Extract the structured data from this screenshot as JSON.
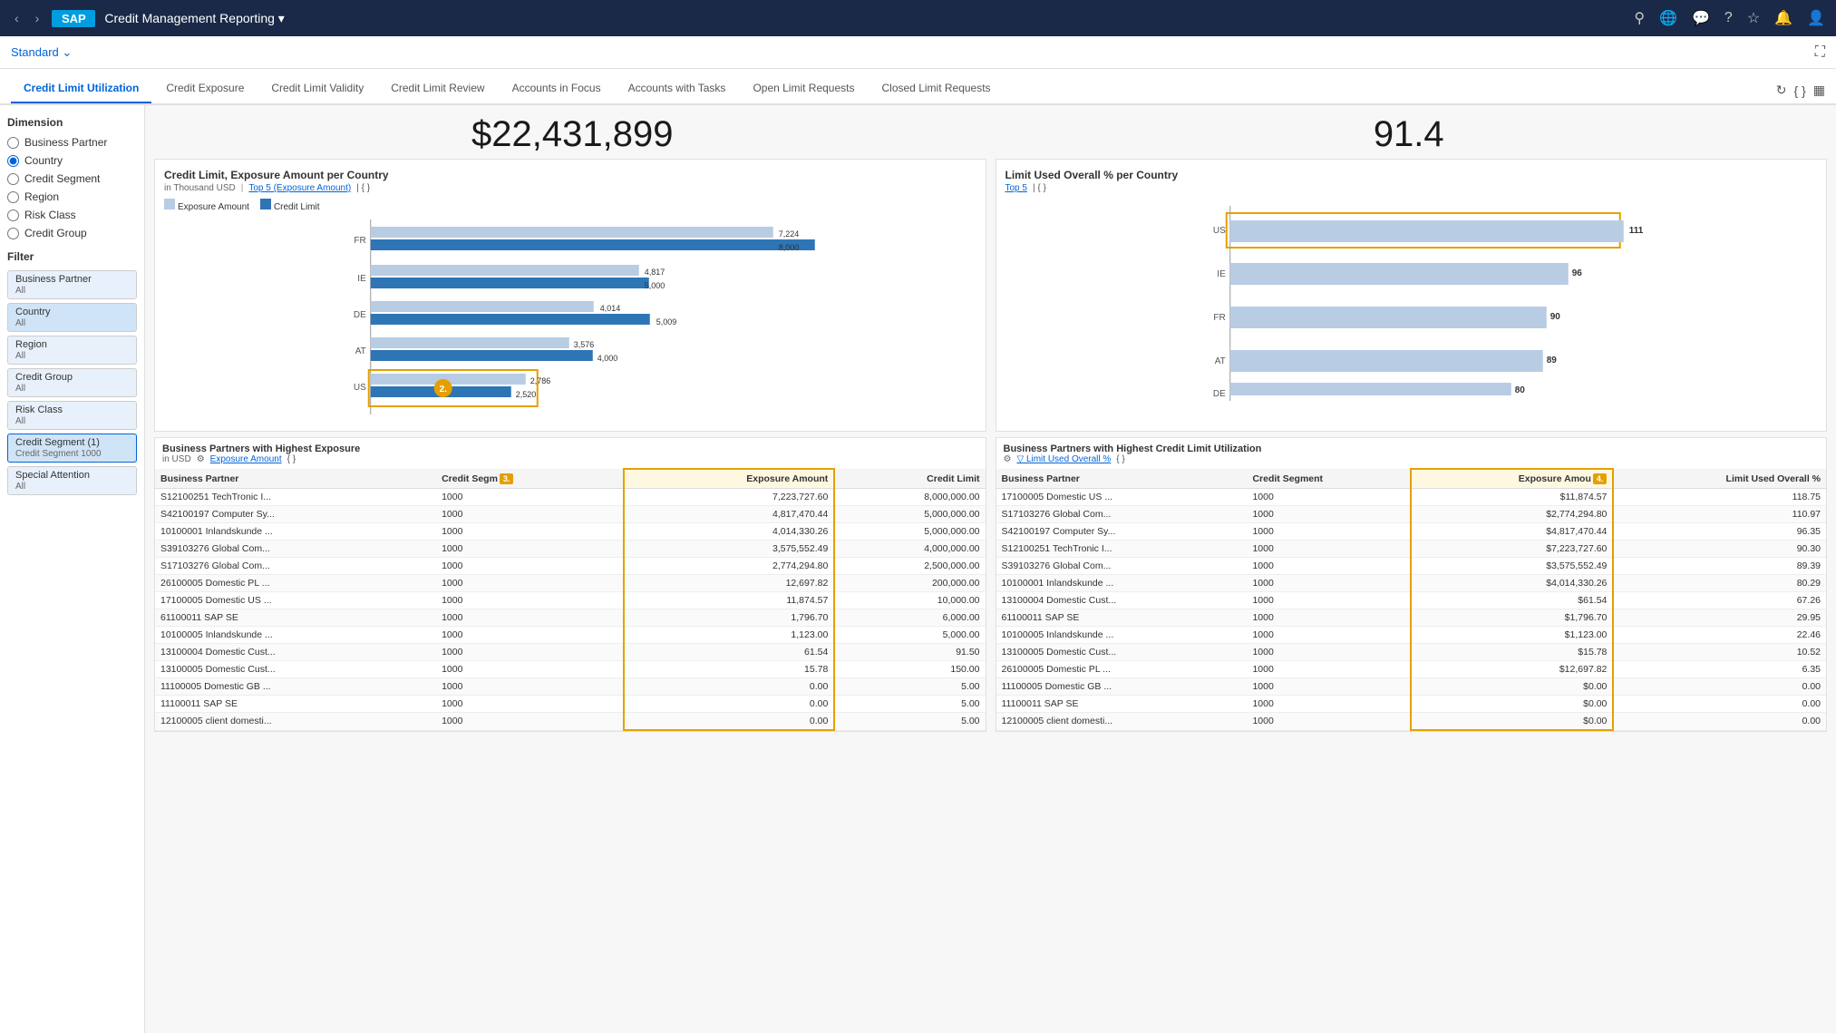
{
  "topbar": {
    "app_title": "Credit Management Reporting ▾",
    "logo": "SAP"
  },
  "second_bar": {
    "standard_label": "Standard ⌄"
  },
  "tabs": [
    {
      "label": "Credit Limit Utilization",
      "active": true
    },
    {
      "label": "Credit Exposure",
      "active": false
    },
    {
      "label": "Credit Limit Validity",
      "active": false
    },
    {
      "label": "Credit Limit Review",
      "active": false
    },
    {
      "label": "Accounts in Focus",
      "active": false
    },
    {
      "label": "Accounts with Tasks",
      "active": false
    },
    {
      "label": "Open Limit Requests",
      "active": false
    },
    {
      "label": "Closed Limit Requests",
      "active": false
    }
  ],
  "kpi": {
    "left_value": "$22,431,899",
    "right_value": "91.4"
  },
  "left_chart": {
    "title": "Credit Limit, Exposure Amount per Country",
    "subtitle_unit": "in Thousand USD",
    "subtitle_link": "Top 5 (Exposure Amount)",
    "legend_exposure": "Exposure Amount",
    "legend_credit": "Credit Limit",
    "bars": [
      {
        "label": "FR",
        "exposure": 7224,
        "credit": 8000,
        "max": 8500
      },
      {
        "label": "IE",
        "exposure": 4817,
        "credit": 5000,
        "max": 8500
      },
      {
        "label": "DE",
        "exposure": 4014,
        "credit": 5009,
        "max": 8500
      },
      {
        "label": "AT",
        "exposure": 3576,
        "credit": 4000,
        "max": 8500
      },
      {
        "label": "US",
        "exposure": 2786,
        "credit": 2520,
        "max": 8500,
        "highlighted": true
      }
    ]
  },
  "right_chart": {
    "title": "Limit Used Overall % per Country",
    "subtitle_link": "Top 5",
    "bars": [
      {
        "label": "US",
        "value": 111,
        "max": 120,
        "highlighted": true,
        "rank": 1
      },
      {
        "label": "IE",
        "value": 96,
        "max": 120
      },
      {
        "label": "FR",
        "value": 90,
        "max": 120
      },
      {
        "label": "AT",
        "value": 89,
        "max": 120
      },
      {
        "label": "DE",
        "value": 80,
        "max": 120
      }
    ]
  },
  "left_table": {
    "title": "Business Partners with Highest Exposure",
    "subtitle": "in USD",
    "sort_label": "Exposure Amount",
    "col_headers": [
      "Business Partner",
      "Credit Segment",
      "Exposure Amount",
      "Credit Limit"
    ],
    "rows": [
      [
        "S12100251 TechTronic I...",
        "1000",
        "7,223,727.60",
        "8,000,000.00"
      ],
      [
        "S42100197 Computer Sy...",
        "1000",
        "4,817,470.44",
        "5,000,000.00"
      ],
      [
        "10100001 Inlandskunde ...",
        "1000",
        "4,014,330.26",
        "5,000,000.00"
      ],
      [
        "S39103276 Global Com...",
        "1000",
        "3,575,552.49",
        "4,000,000.00"
      ],
      [
        "S17103276 Global Com...",
        "1000",
        "2,774,294.80",
        "2,500,000.00"
      ],
      [
        "26100005 Domestic PL ...",
        "1000",
        "12,697.82",
        "200,000.00"
      ],
      [
        "17100005 Domestic US ...",
        "1000",
        "11,874.57",
        "10,000.00"
      ],
      [
        "61100011 SAP SE",
        "1000",
        "1,796.70",
        "6,000.00"
      ],
      [
        "10100005 Inlandskunde ...",
        "1000",
        "1,123.00",
        "5,000.00"
      ],
      [
        "13100004 Domestic Cust...",
        "1000",
        "61.54",
        "91.50"
      ],
      [
        "13100005 Domestic Cust...",
        "1000",
        "15.78",
        "150.00"
      ],
      [
        "11100005 Domestic GB ...",
        "1000",
        "0.00",
        "5.00"
      ],
      [
        "11100011 SAP SE",
        "1000",
        "0.00",
        "5.00"
      ],
      [
        "12100005 client domesti...",
        "1000",
        "0.00",
        "5.00"
      ]
    ]
  },
  "right_table": {
    "title": "Business Partners with Highest Credit Limit Utilization",
    "sort_label": "Limit Used Overall %",
    "col_headers": [
      "Business Partner",
      "Credit Segment",
      "Exposure Amount",
      "Limit Used Overall %"
    ],
    "rows": [
      [
        "17100005 Domestic US ...",
        "1000",
        "$11,874.57",
        "118.75"
      ],
      [
        "S17103276 Global Com...",
        "1000",
        "$2,774,294.80",
        "110.97"
      ],
      [
        "S42100197 Computer Sy...",
        "1000",
        "$4,817,470.44",
        "96.35"
      ],
      [
        "S12100251 TechTronic I...",
        "1000",
        "$7,223,727.60",
        "90.30"
      ],
      [
        "S39103276 Global Com...",
        "1000",
        "$3,575,552.49",
        "89.39"
      ],
      [
        "10100001 Inlandskunde ...",
        "1000",
        "$4,014,330.26",
        "80.29"
      ],
      [
        "13100004 Domestic Cust...",
        "1000",
        "$61.54",
        "67.26"
      ],
      [
        "61100011 SAP SE",
        "1000",
        "$1,796.70",
        "29.95"
      ],
      [
        "10100005 Inlandskunde ...",
        "1000",
        "$1,123.00",
        "22.46"
      ],
      [
        "13100005 Domestic Cust...",
        "1000",
        "$15.78",
        "10.52"
      ],
      [
        "26100005 Domestic PL ...",
        "1000",
        "$12,697.82",
        "6.35"
      ],
      [
        "11100005 Domestic GB ...",
        "1000",
        "$0.00",
        "0.00"
      ],
      [
        "11100011 SAP SE",
        "1000",
        "$0.00",
        "0.00"
      ],
      [
        "12100005 client domesti...",
        "1000",
        "$0.00",
        "0.00"
      ]
    ]
  },
  "sidebar": {
    "dimension_label": "Dimension",
    "items": [
      {
        "label": "Business Partner",
        "selected": false
      },
      {
        "label": "Country",
        "selected": true
      },
      {
        "label": "Credit Segment",
        "selected": false
      },
      {
        "label": "Region",
        "selected": false
      },
      {
        "label": "Risk Class",
        "selected": false
      },
      {
        "label": "Credit Group",
        "selected": false
      }
    ],
    "filter_label": "Filter",
    "filters": [
      {
        "label": "Business Partner",
        "sub": "All"
      },
      {
        "label": "Country",
        "sub": "All"
      },
      {
        "label": "Region",
        "sub": "All"
      },
      {
        "label": "Credit Group",
        "sub": "All"
      },
      {
        "label": "Risk Class",
        "sub": "All"
      },
      {
        "label": "Credit Segment (1)",
        "sub": "Credit Segment 1000"
      },
      {
        "label": "Special Attention",
        "sub": "All"
      }
    ]
  }
}
